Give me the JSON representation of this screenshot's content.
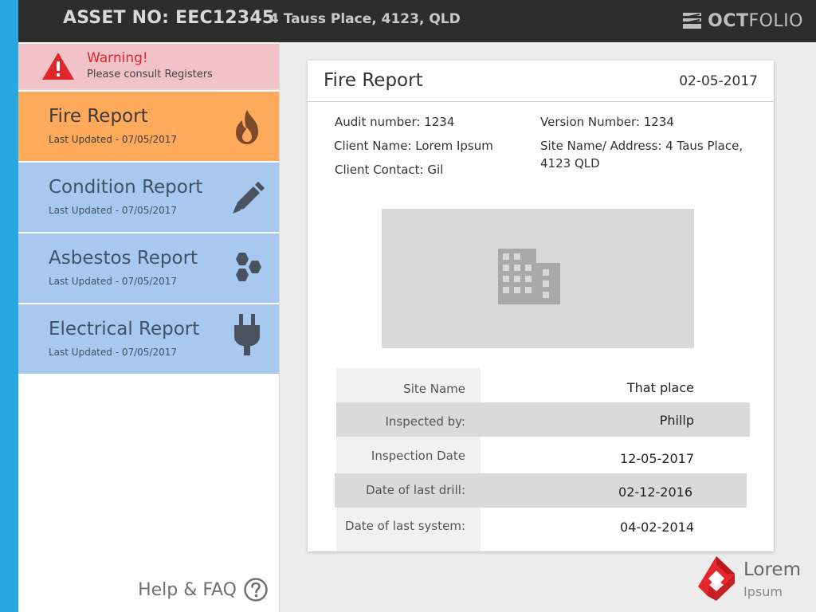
{
  "header": {
    "asset_no": "ASSET NO: EEC12345",
    "address": "4 Tauss Place, 4123, QLD",
    "brand_oct": "OCT",
    "brand_folio": "FOLIO"
  },
  "warning": {
    "title": "Warning!",
    "subtitle": "Please consult Registers"
  },
  "reports": [
    {
      "title": "Fire Report",
      "updated": "Last Updated - 07/05/2017",
      "icon": "fire-icon",
      "color": "#ffa95b"
    },
    {
      "title": "Condition Report",
      "updated": "Last Updated - 07/05/2017",
      "icon": "pencil-icon",
      "color": "#a8c9ef"
    },
    {
      "title": "Asbestos Report",
      "updated": "Last Updated - 07/05/2017",
      "icon": "hexagons-icon",
      "color": "#a8c9ef"
    },
    {
      "title": "Electrical Report",
      "updated": "Last Updated - 07/05/2017",
      "icon": "plug-icon",
      "color": "#a8c9ef"
    }
  ],
  "help": {
    "label": "Help & FAQ"
  },
  "card": {
    "title": "Fire Report",
    "date": "02-05-2017",
    "audit_number": "Audit number: 1234",
    "client_name": "Client Name: Lorem Ipsum",
    "client_contact": "Client Contact: Gil",
    "version_number": "Version Number: 1234",
    "site_address": "Site Name/ Address: 4 Taus Place, 4123 QLD"
  },
  "details": [
    {
      "label": "Site Name",
      "value": "That place"
    },
    {
      "label": "Inspected by:",
      "value": "Phillp"
    },
    {
      "label": "Inspection Date",
      "value": "12-05-2017"
    },
    {
      "label": "Date of last drill:",
      "value": "02-12-2016"
    },
    {
      "label": "Date of last system:",
      "value": "04-02-2014"
    }
  ],
  "logo": {
    "word1": "Lorem",
    "word2": "Ipsum"
  },
  "colors": {
    "accent_stripe": "#27a8e0",
    "header_bg": "#2d2d2d",
    "warning_bg": "#f2c2c9",
    "warning_text": "#e0262d",
    "active_report": "#ffa95b",
    "inactive_report": "#a8c9ef",
    "logo_red": "#e5262d"
  }
}
